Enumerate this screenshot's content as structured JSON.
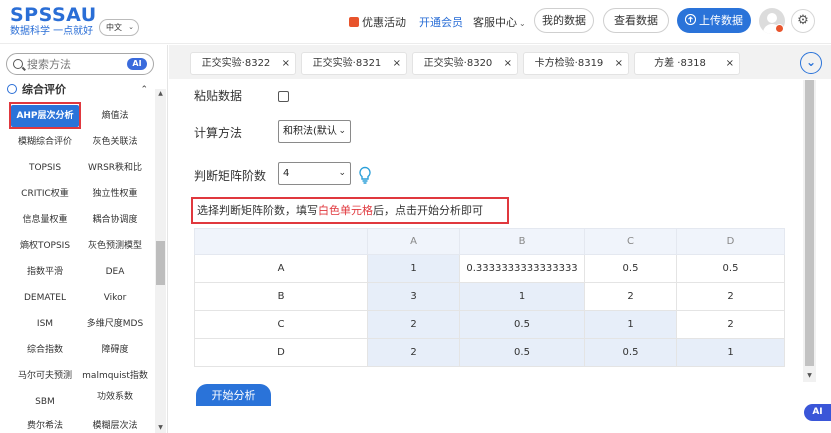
{
  "header": {
    "logo": "SPSSAU",
    "slogan": "数据科学 一点就好",
    "language": "中文",
    "promo": "优惠活动",
    "member": "开通会员",
    "service": "客服中心",
    "my_data": "我的数据",
    "view_data": "查看数据",
    "upload": "上传数据"
  },
  "sidebar": {
    "search_placeholder": "搜索方法",
    "ai_badge": "AI",
    "category": "综合评价",
    "items": [
      "AHP层次分析",
      "熵值法",
      "模糊综合评价",
      "灰色关联法",
      "TOPSIS",
      "WRSR秩和比",
      "CRITIC权重",
      "独立性权重",
      "信息量权重",
      "耦合协调度",
      "熵权TOPSIS",
      "灰色预测模型",
      "指数平滑",
      "DEA",
      "DEMATEL",
      "Vikor",
      "ISM",
      "多维尺度MDS",
      "综合指数",
      "障碍度",
      "马尔可夫预测",
      "malmquist指数",
      "SBM",
      "功效系数",
      "费尔希法",
      "模糊层次法"
    ]
  },
  "tabs": [
    {
      "label": "正交实验·8322",
      "close": "×"
    },
    {
      "label": "正交实验·8321",
      "close": "×"
    },
    {
      "label": "正交实验·8320",
      "close": "×"
    },
    {
      "label": "卡方检验·8319",
      "close": "×"
    },
    {
      "label": "方差 ·8318",
      "close": "×"
    }
  ],
  "form": {
    "paste_label": "粘贴数据",
    "method_label": "计算方法",
    "method_value": "和积法(默认",
    "order_label": "判断矩阵阶数",
    "order_value": "4",
    "hint_pre": "选择判断矩阵阶数，填写",
    "hint_red": "白色单元格",
    "hint_post": "后，点击开始分析即可"
  },
  "matrix": {
    "headers": [
      "",
      "A",
      "B",
      "C",
      "D"
    ],
    "rows": [
      [
        "A",
        "1",
        "0.3333333333333333",
        "0.5",
        "0.5"
      ],
      [
        "B",
        "3",
        "1",
        "2",
        "2"
      ],
      [
        "C",
        "2",
        "0.5",
        "1",
        "2"
      ],
      [
        "D",
        "2",
        "0.5",
        "0.5",
        "1"
      ]
    ]
  },
  "start_button": "开始分析",
  "ai_float": "AI",
  "colors": {
    "primary": "#2a73d9",
    "highlight_red": "#e0383e",
    "cell_shade": "#e7eef9"
  }
}
